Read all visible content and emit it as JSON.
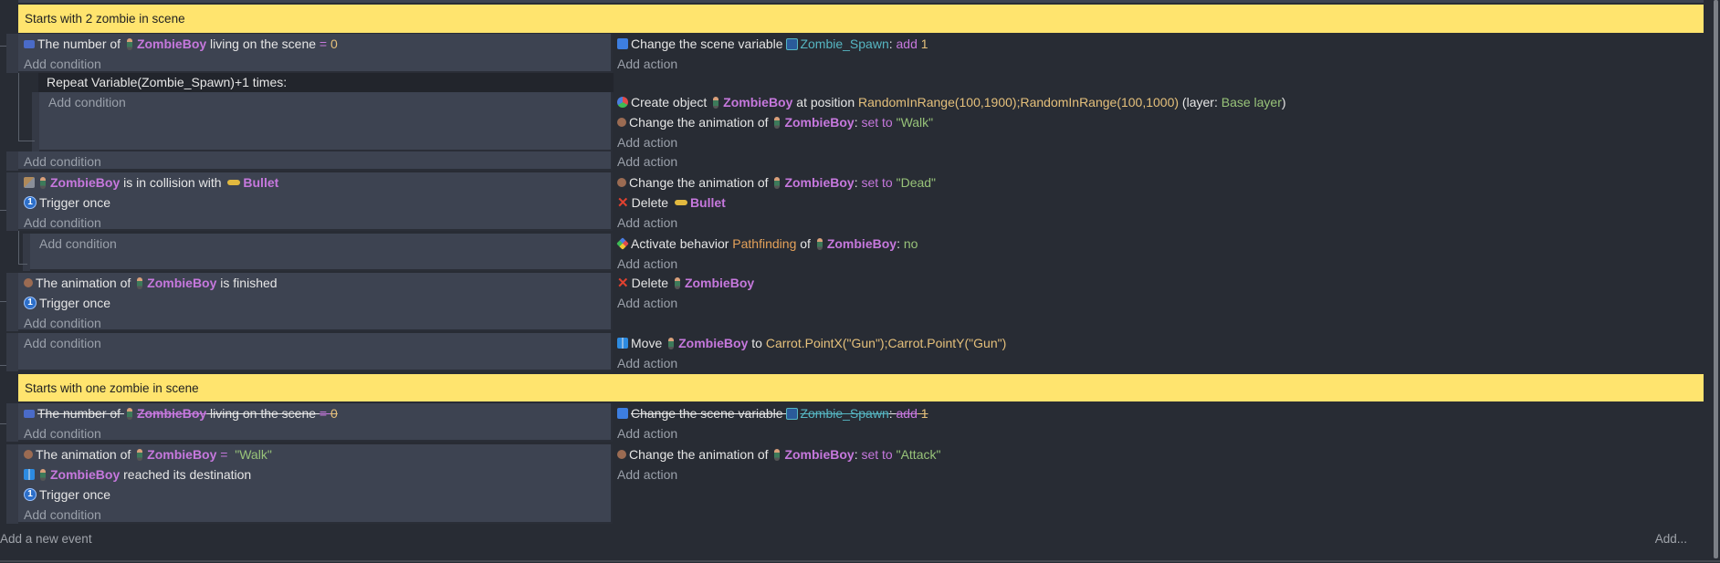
{
  "colors": {
    "comment_bg": "#ffe46e",
    "object": "#c678dd",
    "string": "#98c379",
    "number": "#e5c07b",
    "variable": "#56b6c2",
    "background": "#282c34",
    "condition_bg": "#3d4351"
  },
  "labels": {
    "add_condition": "Add condition",
    "add_action": "Add action",
    "add_new_event": "Add a new event",
    "add_more": "Add..."
  },
  "events": [
    {
      "type": "comment",
      "text": "Starts with 2 zombie in scene"
    },
    {
      "type": "standard",
      "conditions": [
        [
          {
            "icon": "count-icon"
          },
          {
            "t": "The number of ",
            "c": ""
          },
          {
            "icon": "zombie-icon"
          },
          {
            "t": "ZombieBoy",
            "c": "o"
          },
          {
            "t": " living on the scene ",
            "c": ""
          },
          {
            "t": "= ",
            "c": "k"
          },
          {
            "t": "0",
            "c": "y"
          }
        ]
      ],
      "actions": [
        [
          {
            "icon": "var-icon"
          },
          {
            "t": "Change the scene variable ",
            "c": ""
          },
          {
            "icon": "scenevar-icon"
          },
          {
            "t": "Zombie_Spawn",
            "c": "c"
          },
          {
            "t": ": ",
            "c": ""
          },
          {
            "t": "add",
            "c": "k"
          },
          {
            "t": " 1",
            "c": "y"
          }
        ]
      ]
    },
    {
      "type": "repeat",
      "header": "Repeat Variable(Zombie_Spawn)+1 times:",
      "conditions": [],
      "actions": [
        [
          {
            "icon": "create-icon"
          },
          {
            "t": "Create object ",
            "c": ""
          },
          {
            "icon": "zombie-icon"
          },
          {
            "t": "ZombieBoy",
            "c": "o"
          },
          {
            "t": " at position ",
            "c": ""
          },
          {
            "t": "RandomInRange(100,1900);RandomInRange(100,1000)",
            "c": "e"
          },
          {
            "t": " (layer: ",
            "c": ""
          },
          {
            "t": "Base layer",
            "c": "g"
          },
          {
            "t": ")",
            "c": ""
          }
        ],
        [
          {
            "icon": "animation-icon"
          },
          {
            "t": "Change the animation of ",
            "c": ""
          },
          {
            "icon": "zombie-icon"
          },
          {
            "t": "ZombieBoy",
            "c": "o"
          },
          {
            "t": ": ",
            "c": ""
          },
          {
            "t": "set to ",
            "c": "k"
          },
          {
            "t": "\"Walk\"",
            "c": "s"
          }
        ]
      ]
    },
    {
      "type": "standard",
      "conditions": [],
      "actions": []
    },
    {
      "type": "standard",
      "conditions": [
        [
          {
            "icon": "collision-icon"
          },
          {
            "icon": "zombie-icon"
          },
          {
            "t": "ZombieBoy",
            "c": "o"
          },
          {
            "t": " is in collision with ",
            "c": ""
          },
          {
            "icon": "bullet-icon"
          },
          {
            "t": "Bullet",
            "c": "o"
          }
        ],
        [
          {
            "icon": "trigger-once-icon"
          },
          {
            "t": "Trigger once",
            "c": ""
          }
        ]
      ],
      "actions": [
        [
          {
            "icon": "animation-icon"
          },
          {
            "t": "Change the animation of ",
            "c": ""
          },
          {
            "icon": "zombie-icon"
          },
          {
            "t": "ZombieBoy",
            "c": "o"
          },
          {
            "t": ": ",
            "c": ""
          },
          {
            "t": "set to ",
            "c": "k"
          },
          {
            "t": "\"Dead\"",
            "c": "s"
          }
        ],
        [
          {
            "icon": "delete-icon"
          },
          {
            "t": "Delete ",
            "c": ""
          },
          {
            "icon": "bullet-icon"
          },
          {
            "t": "Bullet",
            "c": "o"
          }
        ]
      ]
    },
    {
      "type": "sub",
      "conditions": [],
      "actions": [
        [
          {
            "icon": "behavior-icon"
          },
          {
            "t": "Activate behavior ",
            "c": ""
          },
          {
            "t": "Pathfinding",
            "c": "or"
          },
          {
            "t": " of ",
            "c": ""
          },
          {
            "icon": "zombie-icon"
          },
          {
            "t": "ZombieBoy",
            "c": "o"
          },
          {
            "t": ": ",
            "c": ""
          },
          {
            "t": "no",
            "c": "s"
          }
        ]
      ]
    },
    {
      "type": "standard",
      "conditions": [
        [
          {
            "icon": "animation-icon"
          },
          {
            "t": "The animation of ",
            "c": ""
          },
          {
            "icon": "zombie-icon"
          },
          {
            "t": "ZombieBoy",
            "c": "o"
          },
          {
            "t": " is finished",
            "c": ""
          }
        ],
        [
          {
            "icon": "trigger-once-icon"
          },
          {
            "t": "Trigger once",
            "c": ""
          }
        ]
      ],
      "actions": [
        [
          {
            "icon": "delete-icon"
          },
          {
            "t": "Delete ",
            "c": ""
          },
          {
            "icon": "zombie-icon"
          },
          {
            "t": "ZombieBoy",
            "c": "o"
          }
        ]
      ]
    },
    {
      "type": "standard",
      "conditions": [],
      "actions": [
        [
          {
            "icon": "move-icon"
          },
          {
            "t": "Move ",
            "c": ""
          },
          {
            "icon": "zombie-icon"
          },
          {
            "t": "ZombieBoy",
            "c": "o"
          },
          {
            "t": " to ",
            "c": ""
          },
          {
            "t": "Carrot.PointX(\"Gun\");Carrot.PointY(\"Gun\")",
            "c": "e"
          }
        ]
      ]
    },
    {
      "type": "comment",
      "text": "Starts with one zombie in scene"
    },
    {
      "type": "standard",
      "disabled": true,
      "conditions": [
        [
          {
            "icon": "count-icon"
          },
          {
            "t": "The number of ",
            "c": ""
          },
          {
            "icon": "zombie-icon"
          },
          {
            "t": "ZombieBoy",
            "c": "o"
          },
          {
            "t": " living on the scene ",
            "c": ""
          },
          {
            "t": "= ",
            "c": "k"
          },
          {
            "t": "0",
            "c": "y"
          }
        ]
      ],
      "actions": [
        [
          {
            "icon": "var-icon"
          },
          {
            "t": "Change the scene variable ",
            "c": ""
          },
          {
            "icon": "scenevar-icon"
          },
          {
            "t": "Zombie_Spawn",
            "c": "c"
          },
          {
            "t": ": ",
            "c": ""
          },
          {
            "t": "add",
            "c": "k"
          },
          {
            "t": " 1",
            "c": "y"
          }
        ]
      ]
    },
    {
      "type": "standard",
      "conditions": [
        [
          {
            "icon": "animation-icon"
          },
          {
            "t": "The animation of ",
            "c": ""
          },
          {
            "icon": "zombie-icon"
          },
          {
            "t": "ZombieBoy",
            "c": "o"
          },
          {
            "t": " = ",
            "c": "k"
          },
          {
            "t": " \"Walk\"",
            "c": "s"
          }
        ],
        [
          {
            "icon": "move-icon"
          },
          {
            "icon": "zombie-icon"
          },
          {
            "t": "ZombieBoy",
            "c": "o"
          },
          {
            "t": " reached its destination",
            "c": ""
          }
        ],
        [
          {
            "icon": "trigger-once-icon"
          },
          {
            "t": "Trigger once",
            "c": ""
          }
        ]
      ],
      "actions": [
        [
          {
            "icon": "animation-icon"
          },
          {
            "t": "Change the animation of ",
            "c": ""
          },
          {
            "icon": "zombie-icon"
          },
          {
            "t": "ZombieBoy",
            "c": "o"
          },
          {
            "t": ": ",
            "c": ""
          },
          {
            "t": "set to ",
            "c": "k"
          },
          {
            "t": "\"Attack\"",
            "c": "s"
          }
        ]
      ]
    }
  ]
}
